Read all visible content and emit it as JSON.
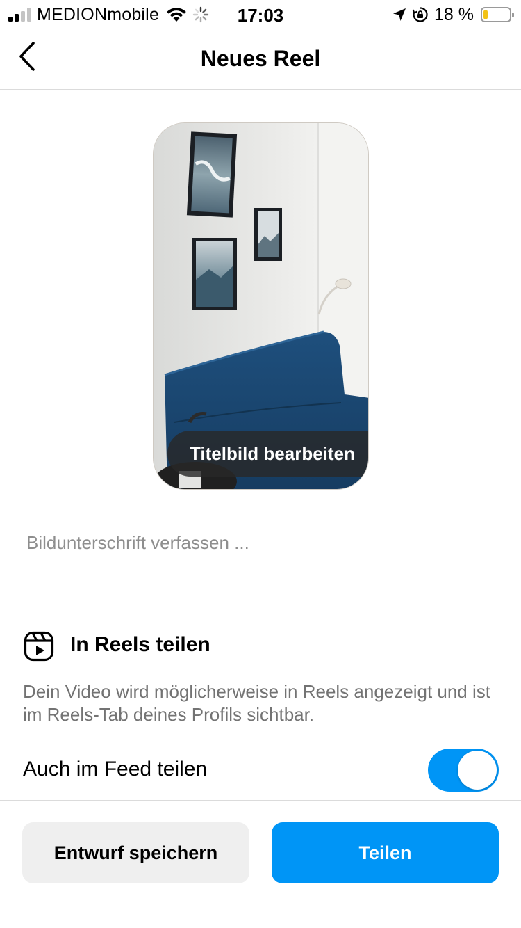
{
  "status_bar": {
    "carrier": "MEDIONmobile",
    "time": "17:03",
    "battery_percent_text": "18 %",
    "battery_level": 0.18,
    "battery_color": "#f2c215",
    "signal_bars_active": 2,
    "icons": [
      "signal-icon",
      "wifi-icon",
      "activity-spinner-icon",
      "location-arrow-icon",
      "rotation-lock-icon",
      "battery-icon"
    ]
  },
  "header": {
    "title": "Neues Reel",
    "back_icon": "chevron-left-icon"
  },
  "thumbnail": {
    "edit_cover_label": "Titelbild bearbeiten"
  },
  "caption": {
    "placeholder": "Bildunterschrift verfassen ...",
    "value": ""
  },
  "reels": {
    "icon": "reels-icon",
    "title": "In Reels teilen",
    "description": "Dein Video wird möglicherweise in Reels angezeigt und ist im Reels-Tab deines Profils sichtbar."
  },
  "feed_share": {
    "label": "Auch im Feed teilen",
    "enabled": true,
    "toggle_color": "#0095f6"
  },
  "actions": {
    "draft_label": "Entwurf speichern",
    "share_label": "Teilen",
    "share_color": "#0095f6"
  }
}
